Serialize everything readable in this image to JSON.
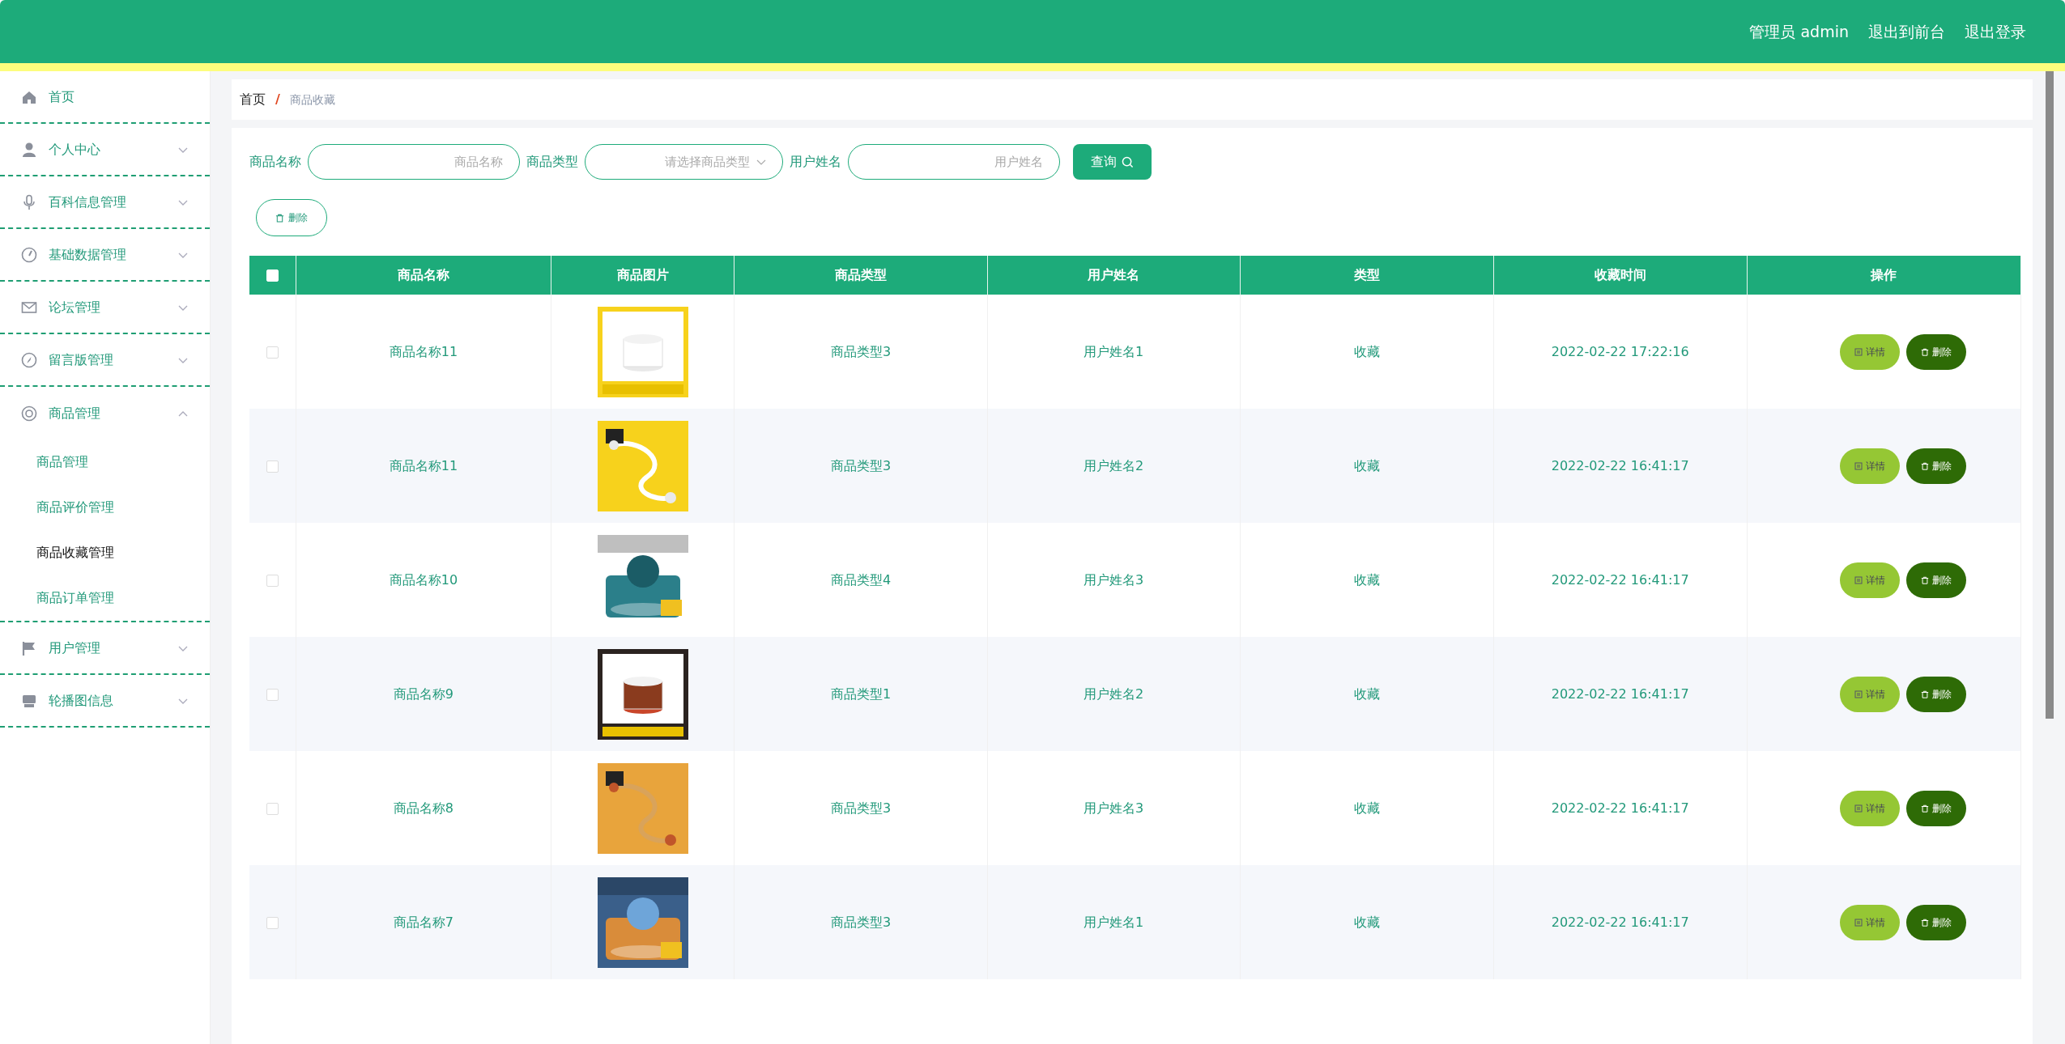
{
  "header": {
    "user_label": "管理员 admin",
    "links": [
      "退出到前台",
      "退出登录"
    ]
  },
  "sidebar": {
    "items": [
      {
        "label": "首页"
      },
      {
        "label": "个人中心",
        "expanded": false
      },
      {
        "label": "百科信息管理",
        "expanded": false
      },
      {
        "label": "基础数据管理",
        "expanded": false
      },
      {
        "label": "论坛管理",
        "expanded": false
      },
      {
        "label": "留言版管理",
        "expanded": false
      },
      {
        "label": "商品管理",
        "expanded": true,
        "children": [
          {
            "label": "商品管理",
            "selected": false
          },
          {
            "label": "商品评价管理",
            "selected": false
          },
          {
            "label": "商品收藏管理",
            "selected": true
          },
          {
            "label": "商品订单管理",
            "selected": false
          }
        ]
      },
      {
        "label": "用户管理",
        "expanded": false
      },
      {
        "label": "轮播图信息",
        "expanded": false
      }
    ]
  },
  "breadcrumb": [
    "首页",
    "商品收藏"
  ],
  "breadcrumb_separator": "/",
  "filters": [
    {
      "label": "商品名称",
      "placeholder": "商品名称",
      "kind": "text"
    },
    {
      "label": "商品类型",
      "placeholder": "请选择商品类型",
      "kind": "select"
    },
    {
      "label": "用户姓名",
      "placeholder": "用户姓名",
      "kind": "text"
    }
  ],
  "search_button": "查询",
  "bulk_delete_button": "删除",
  "table": {
    "select_all": {
      "checked": false
    },
    "columns": [
      "商品名称",
      "商品图片",
      "商品类型",
      "用户姓名",
      "类型",
      "收藏时间",
      "操作"
    ],
    "rows": [
      {
        "checked": false,
        "name": "商品名称11",
        "image": {
          "kind": "picture"
        },
        "type": "商品类型3",
        "user": "用户姓名1",
        "category": "收藏",
        "time": "2022-02-22 17:22:16",
        "actions": [
          "详情",
          "删除"
        ]
      },
      {
        "checked": false,
        "name": "商品名称11",
        "image": {
          "kind": "picture"
        },
        "type": "商品类型3",
        "user": "用户姓名2",
        "category": "收藏",
        "time": "2022-02-22 16:41:17",
        "actions": [
          "详情",
          "删除"
        ]
      },
      {
        "checked": false,
        "name": "商品名称10",
        "image": {
          "kind": "picture"
        },
        "type": "商品类型4",
        "user": "用户姓名3",
        "category": "收藏",
        "time": "2022-02-22 16:41:17",
        "actions": [
          "详情",
          "删除"
        ]
      },
      {
        "checked": false,
        "name": "商品名称9",
        "image": {
          "kind": "picture"
        },
        "type": "商品类型1",
        "user": "用户姓名2",
        "category": "收藏",
        "time": "2022-02-22 16:41:17",
        "actions": [
          "详情",
          "删除"
        ]
      },
      {
        "checked": false,
        "name": "商品名称8",
        "image": {
          "kind": "picture"
        },
        "type": "商品类型3",
        "user": "用户姓名3",
        "category": "收藏",
        "time": "2022-02-22 16:41:17",
        "actions": [
          "详情",
          "删除"
        ]
      },
      {
        "checked": false,
        "name": "商品名称7",
        "image": {
          "kind": "picture"
        },
        "type": "商品类型3",
        "user": "用户姓名1",
        "category": "收藏",
        "time": "2022-02-22 16:41:17",
        "actions": [
          "详情",
          "删除"
        ]
      }
    ]
  }
}
